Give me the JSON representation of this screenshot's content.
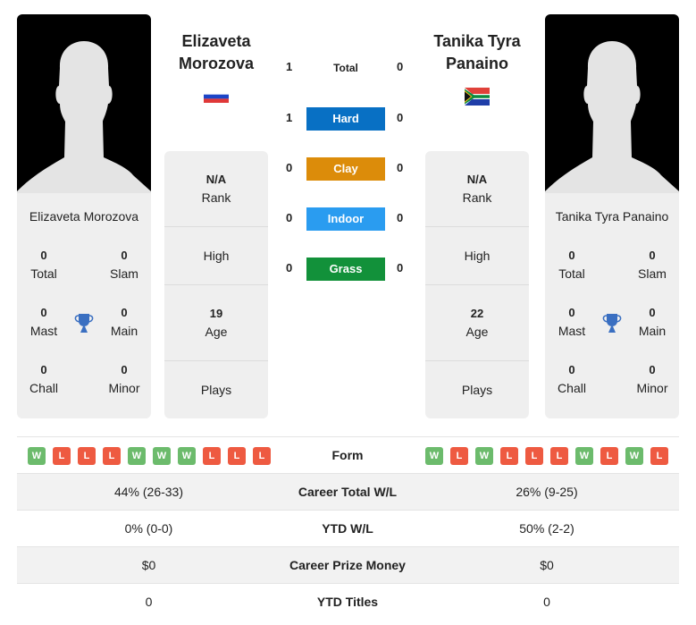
{
  "colors": {
    "hard": "#0870c4",
    "clay": "#dc8c0a",
    "indoor": "#2a9cf0",
    "grass": "#12913a",
    "win": "#6cbb6c",
    "loss": "#ee5a41",
    "trophy": "#3a6fc1"
  },
  "left_player": {
    "name_line1": "Elizaveta",
    "name_line2": "Morozova",
    "full_name": "Elizaveta Morozova",
    "flag": "russia-flag",
    "titles": {
      "total": {
        "value": "0",
        "label": "Total"
      },
      "slam": {
        "value": "0",
        "label": "Slam"
      },
      "mast": {
        "value": "0",
        "label": "Mast"
      },
      "main": {
        "value": "0",
        "label": "Main"
      },
      "chall": {
        "value": "0",
        "label": "Chall"
      },
      "minor": {
        "value": "0",
        "label": "Minor"
      }
    },
    "info": {
      "rank": {
        "value": "N/A",
        "label": "Rank"
      },
      "high": {
        "value": "",
        "label": "High"
      },
      "age": {
        "value": "19",
        "label": "Age"
      },
      "plays": {
        "value": "",
        "label": "Plays"
      }
    }
  },
  "right_player": {
    "name_line1": "Tanika Tyra",
    "name_line2": "Panaino",
    "full_name": "Tanika Tyra Panaino",
    "flag": "south-africa-flag",
    "titles": {
      "total": {
        "value": "0",
        "label": "Total"
      },
      "slam": {
        "value": "0",
        "label": "Slam"
      },
      "mast": {
        "value": "0",
        "label": "Mast"
      },
      "main": {
        "value": "0",
        "label": "Main"
      },
      "chall": {
        "value": "0",
        "label": "Chall"
      },
      "minor": {
        "value": "0",
        "label": "Minor"
      }
    },
    "info": {
      "rank": {
        "value": "N/A",
        "label": "Rank"
      },
      "high": {
        "value": "",
        "label": "High"
      },
      "age": {
        "value": "22",
        "label": "Age"
      },
      "plays": {
        "value": "",
        "label": "Plays"
      }
    }
  },
  "h2h": [
    {
      "label": "Total",
      "left": "1",
      "right": "0",
      "surface": "total"
    },
    {
      "label": "Hard",
      "left": "1",
      "right": "0",
      "surface": "hard"
    },
    {
      "label": "Clay",
      "left": "0",
      "right": "0",
      "surface": "clay"
    },
    {
      "label": "Indoor",
      "left": "0",
      "right": "0",
      "surface": "indoor"
    },
    {
      "label": "Grass",
      "left": "0",
      "right": "0",
      "surface": "grass"
    }
  ],
  "comparison": {
    "form": {
      "label": "Form",
      "left": [
        "W",
        "L",
        "L",
        "L",
        "W",
        "W",
        "W",
        "L",
        "L",
        "L"
      ],
      "right": [
        "W",
        "L",
        "W",
        "L",
        "L",
        "L",
        "W",
        "L",
        "W",
        "L"
      ]
    },
    "rows": [
      {
        "label": "Career Total W/L",
        "left": "44% (26-33)",
        "right": "26% (9-25)"
      },
      {
        "label": "YTD W/L",
        "left": "0% (0-0)",
        "right": "50% (2-2)"
      },
      {
        "label": "Career Prize Money",
        "left": "$0",
        "right": "$0"
      },
      {
        "label": "YTD Titles",
        "left": "0",
        "right": "0"
      }
    ]
  }
}
